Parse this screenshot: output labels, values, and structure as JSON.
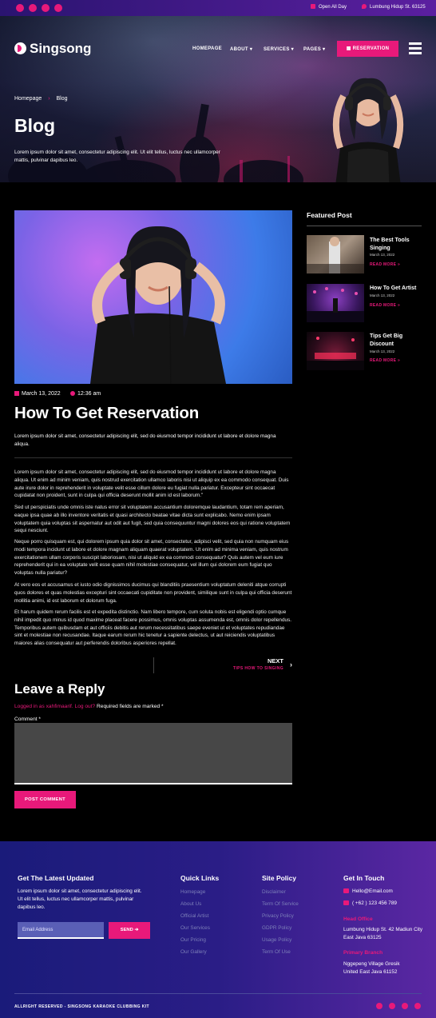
{
  "topbar": {
    "hours": "Open All Day",
    "address": "Lumbung Hidup St. 63125"
  },
  "brand": {
    "name": "Singsong"
  },
  "nav": {
    "home": "HOMEPAGE",
    "about": "ABOUT",
    "services": "SERVICES",
    "pages": "PAGES",
    "reservation": "RESERVATION"
  },
  "hero": {
    "breadcrumb_home": "Homepage",
    "breadcrumb_current": "Blog",
    "title": "Blog",
    "desc": "Lorem ipsum dolor sit amet, consectetur adipiscing elit. Ut elit tellus, luctus nec ullamcorper mattis, pulvinar dapibus leo."
  },
  "post": {
    "date": "March 13, 2022",
    "time": "12:36 am",
    "title": "How To Get Reservation",
    "lead": "Lorem ipsum dolor sit amet, consectetur adipiscing elit, sed do eiusmod tempor incididunt ut labore et dolore magna aliqua.",
    "paragraphs": [
      "Lorem ipsum dolor sit amet, consectetur adipiscing elit, sed do eiusmod tempor incididunt ut labore et dolore magna aliqua. Ut enim ad minim veniam, quis nostrud exercitation ullamco laboris nisi ut aliquip ex ea commodo consequat. Duis aute irure dolor in reprehenderit in voluptate velit esse cillum dolore eu fugiat nulla pariatur. Excepteur sint occaecat cupidatat non proident, sunt in culpa qui officia deserunt mollit anim id est laborum.\"",
      "Sed ut perspiciatis unde omnis iste natus error sit voluptatem accusantium doloremque laudantium, totam rem aperiam, eaque ipsa quae ab illo inventore veritatis et quasi architecto beatae vitae dicta sunt explicabo. Nemo enim ipsam voluptatem quia voluptas sit aspernatur aut odit aut fugit, sed quia consequuntur magni dolores eos qui ratione voluptatem sequi nesciunt.",
      "Neque porro quisquam est, qui dolorem ipsum quia dolor sit amet, consectetur, adipisci velit, sed quia non numquam eius modi tempora incidunt ut labore et dolore magnam aliquam quaerat voluptatem. Ut enim ad minima veniam, quis nostrum exercitationem ullam corporis suscipit laboriosam, nisi ut aliquid ex ea commodi consequatur? Quis autem vel eum iure reprehenderit qui in ea voluptate velit esse quam nihil molestiae consequatur, vel illum qui dolorem eum fugiat quo voluptas nulla pariatur?",
      "At vero eos et accusamus et iusto odio dignissimos ducimus qui blanditiis praesentium voluptatum deleniti atque corrupti quos dolores et quas molestias excepturi sint occaecati cupiditate non provident, similique sunt in culpa qui officia deserunt mollitia animi, id est laborum et dolorum fuga.",
      "Et harum quidem rerum facilis est et expedita distinctio. Nam libero tempore, cum soluta nobis est eligendi optio cumque nihil impedit quo minus id quod maxime placeat facere possimus, omnis voluptas assumenda est, omnis dolor repellendus. Temporibus autem quibusdam et aut officiis debitis aut rerum necessitatibus saepe eveniet ut et voluptates repudiandae sint et molestiae non recusandae. Itaque earum rerum hic tenetur a sapiente delectus, ut aut reiciendis voluptatibus maiores alias consequatur aut perferendis doloribus asperiores repellat."
    ],
    "next_label": "NEXT",
    "next_title": "TIPS HOW TO SINGING"
  },
  "reply": {
    "title": "Leave a Reply",
    "logged_in": "Logged in as xahfimaarif.",
    "logout": "Log out?",
    "required": "Required fields are marked *",
    "comment_label": "Comment *",
    "submit": "POST COMMENT"
  },
  "sidebar": {
    "title": "Featured Post",
    "items": [
      {
        "title": "The Best Tools Singing",
        "date": "March 13, 2022",
        "more": "READ MORE »"
      },
      {
        "title": "How To Get Artist",
        "date": "March 13, 2022",
        "more": "READ MORE »"
      },
      {
        "title": "Tips Get Big Discount",
        "date": "March 13, 2022",
        "more": "READ MORE »"
      }
    ]
  },
  "footer": {
    "newsletter_title": "Get The Latest Updated",
    "newsletter_desc": "Lorem ipsum dolor sit amet, consectetur adipiscing elit. Ut elit tellus, luctus nec ullamcorper mattis, pulvinar dapibus leo.",
    "email_placeholder": "Email Address",
    "send": "SEND",
    "quick_title": "Quick Links",
    "quick_links": [
      "Homepage",
      "About Us",
      "Official Artist",
      "Our Services",
      "Our Pricing",
      "Our Gallery"
    ],
    "policy_title": "Site Policy",
    "policy_links": [
      "Disclaimer",
      "Term Of Service",
      "Privacy Policy",
      "GDPR Policy",
      "Usage Policy",
      "Term Of Use"
    ],
    "touch_title": "Get In Touch",
    "email": "Hello@Email.com",
    "phone": "( +62 ) 123 456 789",
    "head_office_label": "Head Office",
    "head_office": "Lumbung Hidup St. 42 Madiun City East Java 63125",
    "branch_label": "Primary Branch",
    "branch": "Nggepeng Village Gresik United East Java 61152",
    "copyright": "ALLRIGHT RESERVED - SINGSONG KARAOKE CLUBBING KIT"
  }
}
